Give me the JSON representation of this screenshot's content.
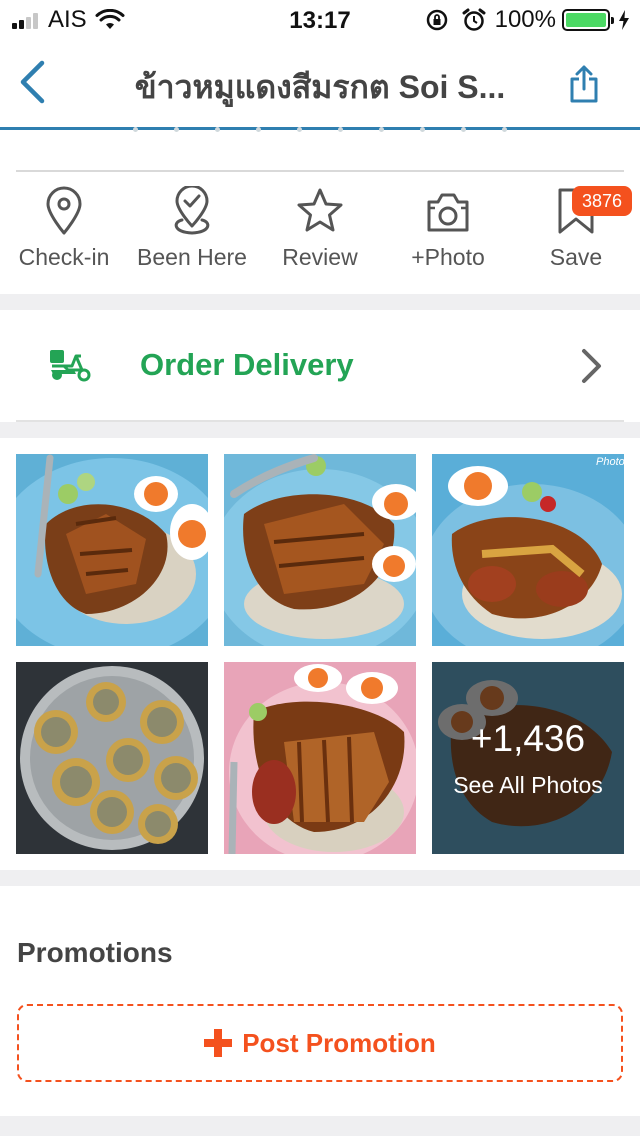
{
  "status_bar": {
    "carrier": "AIS",
    "time": "13:17",
    "battery_percent": "100%",
    "battery_level": 1.0
  },
  "nav": {
    "title": "ข้าวหมูแดงสีมรกต Soi S...",
    "back_icon": "chevron-left-icon",
    "share_icon": "share-icon"
  },
  "actions": [
    {
      "label": "Check-in",
      "icon": "location-pin-icon"
    },
    {
      "label": "Been Here",
      "icon": "pin-check-icon"
    },
    {
      "label": "Review",
      "icon": "star-icon"
    },
    {
      "label": "+Photo",
      "icon": "camera-icon"
    },
    {
      "label": "Save",
      "icon": "bookmark-icon",
      "badge": "3876"
    }
  ],
  "delivery": {
    "label": "Order Delivery",
    "icon": "scooter-icon",
    "accent": "#23a455"
  },
  "photos": {
    "more_count": "+1,436",
    "see_all_label": "See All Photos",
    "watermark": "Photo"
  },
  "promotions": {
    "title": "Promotions",
    "button_label": "Post Promotion",
    "accent": "#f4511e"
  },
  "colors": {
    "nav_accent": "#2f7fb0",
    "icon_gray": "#555555"
  }
}
